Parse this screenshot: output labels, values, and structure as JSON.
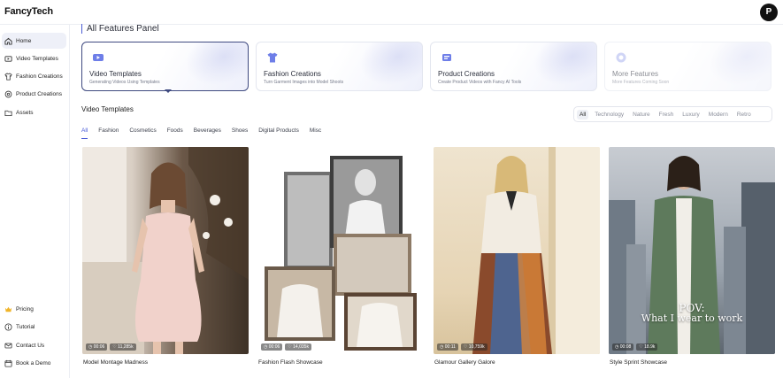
{
  "app": {
    "brand": "FancyTech",
    "avatar_initial": "P"
  },
  "sidebar": {
    "items": [
      {
        "label": "Home",
        "icon": "home-icon",
        "active": true
      },
      {
        "label": "Video Templates",
        "icon": "video-icon"
      },
      {
        "label": "Fashion Creations",
        "icon": "shirt-icon"
      },
      {
        "label": "Product Creations",
        "icon": "product-icon"
      },
      {
        "label": "Assets",
        "icon": "folder-icon"
      }
    ],
    "bottom_items": [
      {
        "label": "Pricing",
        "icon": "crown-icon"
      },
      {
        "label": "Tutorial",
        "icon": "info-icon"
      },
      {
        "label": "Contact Us",
        "icon": "mail-icon"
      },
      {
        "label": "Book a Demo",
        "icon": "calendar-icon"
      }
    ]
  },
  "panel": {
    "title": "All Features Panel",
    "features": [
      {
        "title": "Video Templates",
        "subtitle": "Generating Videos Using Templates",
        "icon": "video-template-icon",
        "active": true
      },
      {
        "title": "Fashion Creations",
        "subtitle": "Turn Garment Images into Model Shoots",
        "icon": "fashion-icon"
      },
      {
        "title": "Product Creations",
        "subtitle": "Create Product Videos with Fancy AI Tools",
        "icon": "product-creation-icon"
      },
      {
        "title": "More Features",
        "subtitle": "More Features Coming Soon",
        "icon": "more-features-icon",
        "disabled": true
      }
    ]
  },
  "templates": {
    "section_title": "Video Templates",
    "filters": [
      "All",
      "Technology",
      "Nature",
      "Fresh",
      "Luxury",
      "Modern",
      "Retro"
    ],
    "active_filter": "All",
    "categories": [
      "All",
      "Fashion",
      "Cosmetics",
      "Foods",
      "Beverages",
      "Shoes",
      "Digital Products",
      "Misc"
    ],
    "active_category": "All",
    "cards": [
      {
        "title": "Model Montage Madness",
        "duration": "00:06",
        "likes": "11,285k"
      },
      {
        "title": "Fashion Flash Showcase",
        "duration": "00:06",
        "likes": "14,035k"
      },
      {
        "title": "Glamour Gallery Galore",
        "duration": "00:11",
        "likes": "10,759k"
      },
      {
        "title": "Style Sprint Showcase",
        "duration": "00:08",
        "likes": "18.9k",
        "overlay_line1": "POV:",
        "overlay_line2": "What I wear to work"
      }
    ]
  },
  "colors": {
    "accent": "#4457d6",
    "active_border": "#3f4a80"
  }
}
